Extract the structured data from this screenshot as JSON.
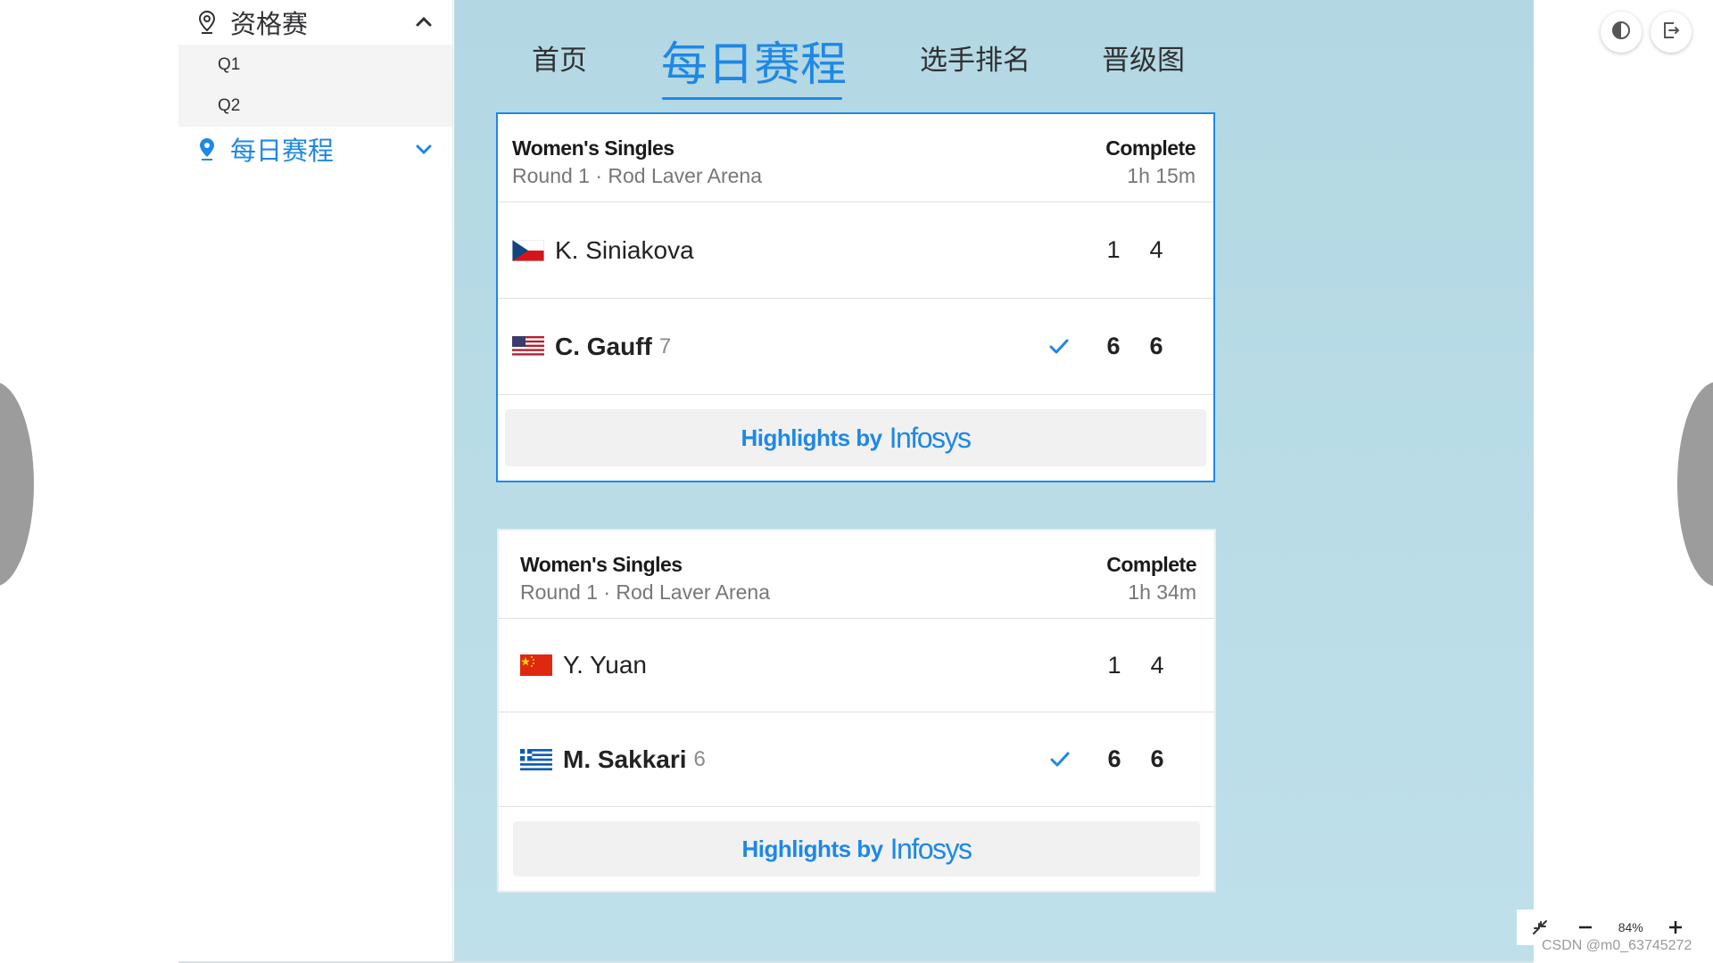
{
  "sidebar": {
    "groups": [
      {
        "label": "资格赛",
        "expanded": true,
        "items": [
          {
            "label": "Q1"
          },
          {
            "label": "Q2"
          }
        ]
      },
      {
        "label": "每日赛程",
        "expanded": false,
        "active": true
      }
    ]
  },
  "tabs": [
    {
      "label": "首页"
    },
    {
      "label": "每日赛程",
      "active": true
    },
    {
      "label": "选手排名"
    },
    {
      "label": "晋级图"
    }
  ],
  "matches": [
    {
      "event": "Women's Singles",
      "round": "Round 1 · Rod Laver Arena",
      "status": "Complete",
      "duration": "1h 15m",
      "players": [
        {
          "name": "K. Siniakova",
          "seed": "",
          "flag": "czech-flag",
          "winner": false,
          "scores": [
            "1",
            "4"
          ]
        },
        {
          "name": "C. Gauff",
          "seed": "7",
          "flag": "usa-flag",
          "winner": true,
          "scores": [
            "6",
            "6"
          ]
        }
      ],
      "highlights_label": "Highlights by",
      "highlights_brand": "Infosys"
    },
    {
      "event": "Women's Singles",
      "round": "Round 1 · Rod Laver Arena",
      "status": "Complete",
      "duration": "1h 34m",
      "players": [
        {
          "name": "Y. Yuan",
          "seed": "",
          "flag": "china-flag",
          "winner": false,
          "scores": [
            "1",
            "4"
          ]
        },
        {
          "name": "M. Sakkari",
          "seed": "6",
          "flag": "greece-flag",
          "winner": true,
          "scores": [
            "6",
            "6"
          ]
        }
      ],
      "highlights_label": "Highlights by",
      "highlights_brand": "Infosys"
    }
  ],
  "zoom": {
    "level": "84%"
  },
  "watermark": "CSDN @m0_63745272",
  "colors": {
    "accent": "#1e88e5",
    "main_bg": "#b3d8e3"
  }
}
